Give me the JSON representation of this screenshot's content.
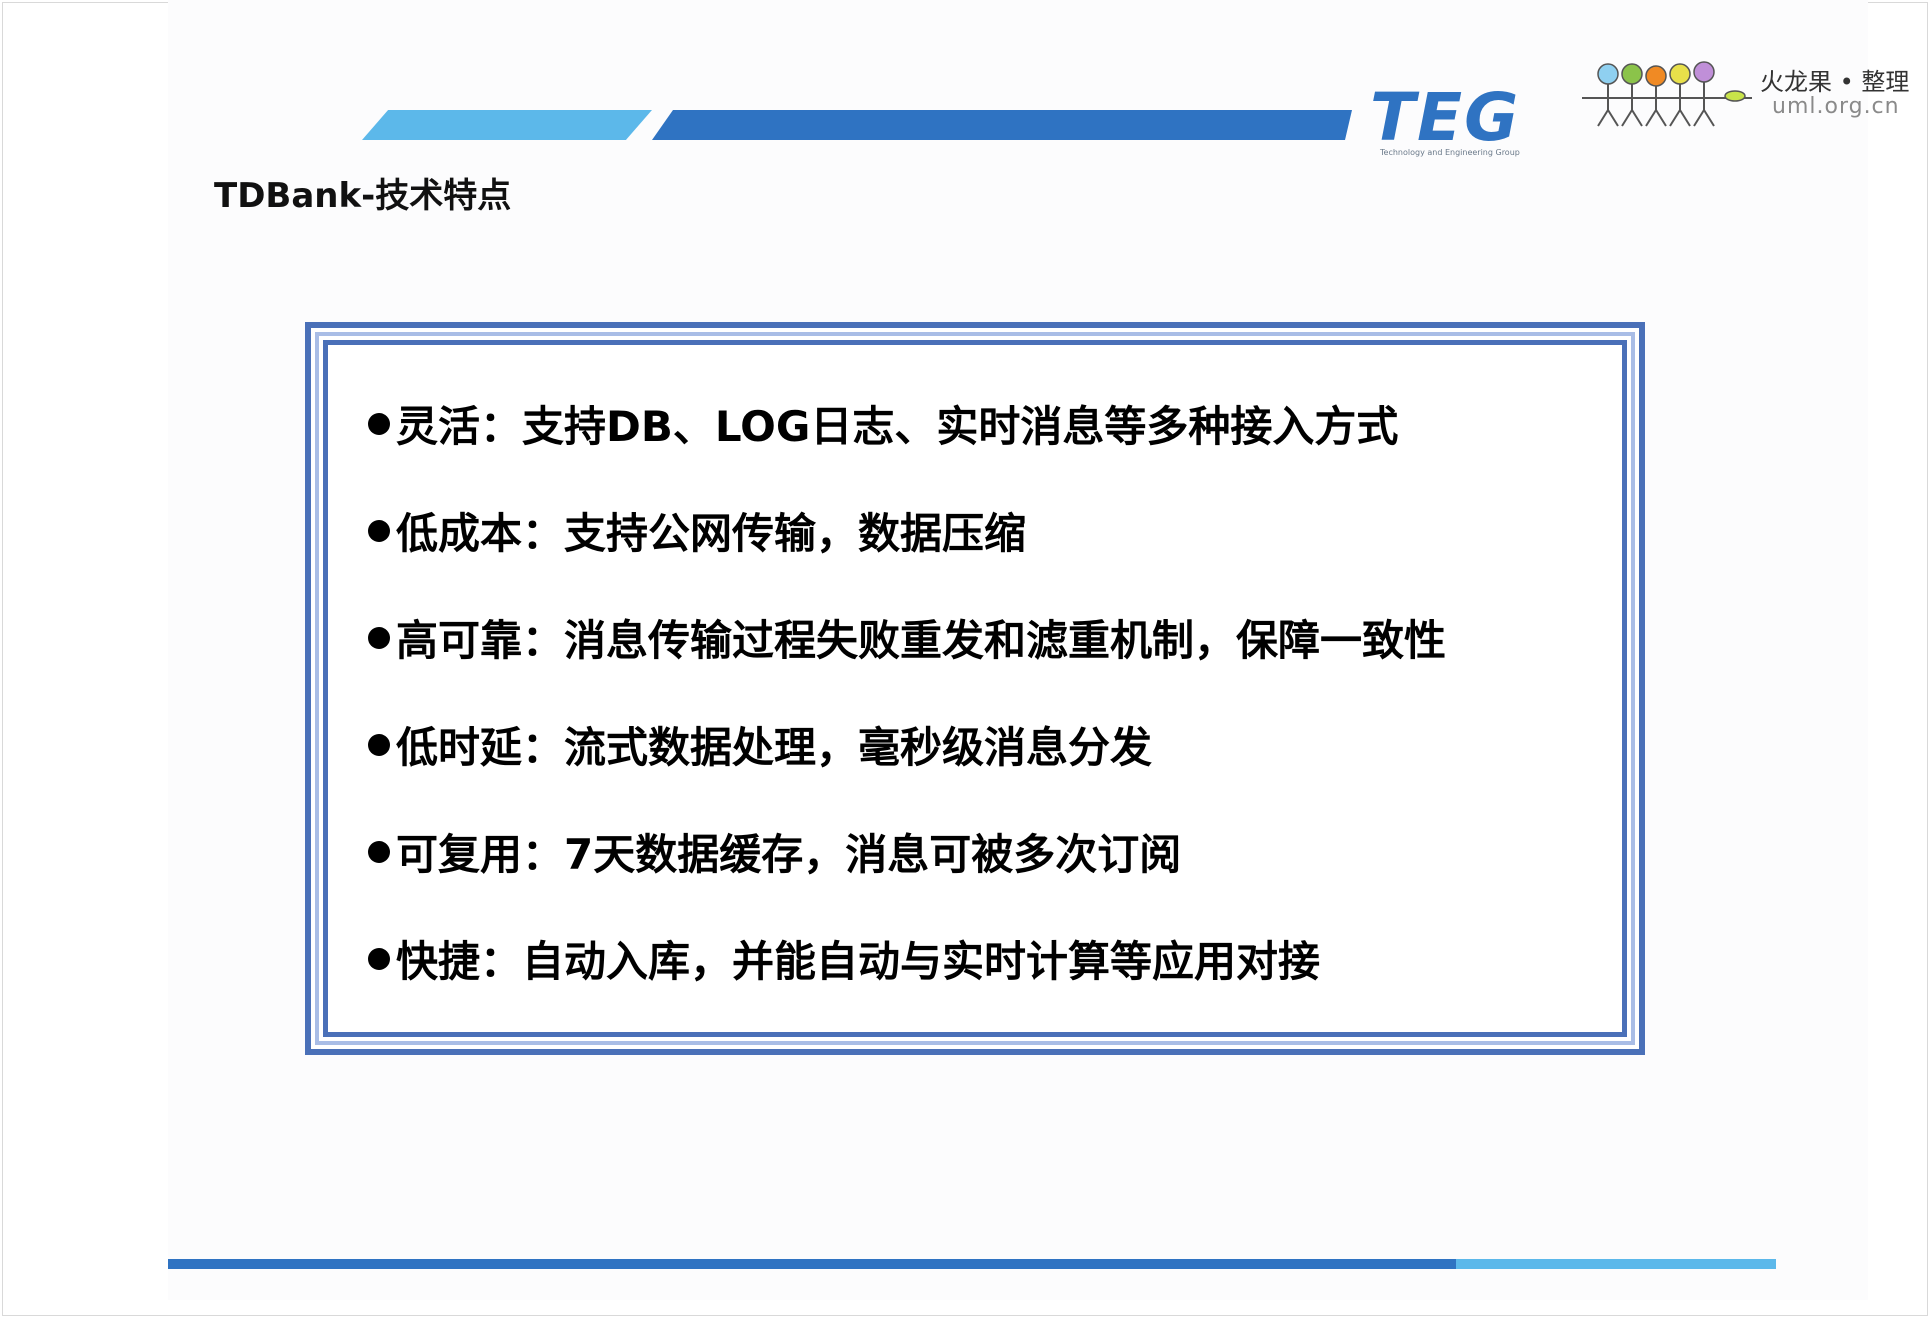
{
  "header": {
    "logo_text": "TEG",
    "logo_subtitle": "Technology and Engineering Group",
    "watermark_title": "火龙果 • 整理",
    "watermark_url": "uml.org.cn"
  },
  "slide": {
    "title": "TDBank-技术特点",
    "features": [
      {
        "label": "灵活",
        "separator": "：",
        "desc": "支持DB、LOG日志、实时消息等多种接入方式"
      },
      {
        "label": "低成本",
        "separator": "：",
        "desc": "支持公网传输，数据压缩"
      },
      {
        "label": "高可靠",
        "separator": "：",
        "desc": "消息传输过程失败重发和滤重机制，保障一致性"
      },
      {
        "label": "低时延",
        "separator": "：",
        "desc": "流式数据处理，毫秒级消息分发"
      },
      {
        "label": "可复用",
        "separator": "： ",
        "desc": "7天数据缓存，消息可被多次订阅"
      },
      {
        "label": "快捷",
        "separator": "：",
        "desc": "自动入库，并能自动与实时计算等应用对接"
      }
    ]
  },
  "colors": {
    "brand_dark": "#2f73c2",
    "brand_light": "#5cb8ea",
    "frame": "#4a70b8"
  }
}
